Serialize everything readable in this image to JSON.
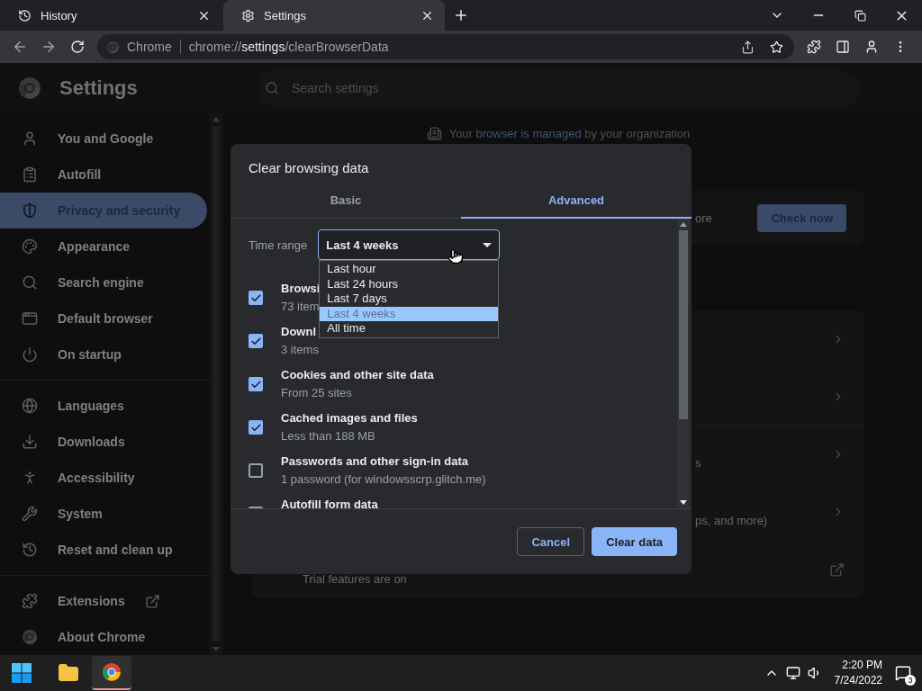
{
  "browser_tabs": [
    {
      "title": "History",
      "selected": false
    },
    {
      "title": "Settings",
      "selected": true
    }
  ],
  "omnibox": {
    "chip": "Chrome",
    "url": "chrome://**settings**/clearBrowserData"
  },
  "settings_header": {
    "title": "Settings",
    "search_placeholder": "Search settings"
  },
  "sidebar": {
    "groups": [
      [
        {
          "label": "You and Google",
          "selected": false
        },
        {
          "label": "Autofill",
          "selected": false
        },
        {
          "label": "Privacy and security",
          "selected": true
        },
        {
          "label": "Appearance",
          "selected": false
        },
        {
          "label": "Search engine",
          "selected": false
        },
        {
          "label": "Default browser",
          "selected": false
        },
        {
          "label": "On startup",
          "selected": false
        }
      ],
      [
        {
          "label": "Languages",
          "selected": false
        },
        {
          "label": "Downloads",
          "selected": false
        },
        {
          "label": "Accessibility",
          "selected": false
        },
        {
          "label": "System",
          "selected": false
        },
        {
          "label": "Reset and clean up",
          "selected": false
        }
      ],
      [
        {
          "label": "Extensions",
          "selected": false,
          "external": true
        },
        {
          "label": "About Chrome",
          "selected": false
        }
      ]
    ]
  },
  "managed_notice": {
    "before": "Your",
    "link": "browser is managed",
    "after": "by your organization"
  },
  "safety_card": {
    "fragment": "ore",
    "button": "Check now"
  },
  "privacy_card": {
    "rows": [
      {
        "kind": "link"
      },
      {
        "kind": "link"
      },
      {
        "kind": "link",
        "fragment": "s"
      },
      {
        "kind": "link",
        "fragment": "ps, and more)"
      },
      {
        "kind": "external",
        "note": "Trial features are on"
      }
    ]
  },
  "dialog": {
    "title": "Clear browsing data",
    "tabs": [
      {
        "label": "Basic",
        "selected": false
      },
      {
        "label": "Advanced",
        "selected": true
      }
    ],
    "time_range": {
      "label": "Time range",
      "value": "Last 4 weeks",
      "open": true,
      "options": [
        {
          "label": "Last hour",
          "selected": false
        },
        {
          "label": "Last 24 hours",
          "selected": false
        },
        {
          "label": "Last 7 days",
          "selected": false
        },
        {
          "label": "Last 4 weeks",
          "selected": true
        },
        {
          "label": "All time",
          "selected": false
        }
      ]
    },
    "items": [
      {
        "title": "Browsi",
        "detail": "73 item",
        "checked": true
      },
      {
        "title": "Downl",
        "detail": "3 items",
        "checked": true
      },
      {
        "title": "Cookies and other site data",
        "detail": "From 25 sites",
        "checked": true
      },
      {
        "title": "Cached images and files",
        "detail": "Less than 188 MB",
        "checked": true
      },
      {
        "title": "Passwords and other sign-in data",
        "detail": "1 password (for windowsscrp.glitch.me)",
        "checked": false
      },
      {
        "title": "Autofill form data",
        "checked": false
      }
    ],
    "buttons": [
      {
        "label": "Cancel",
        "kind": "secondary"
      },
      {
        "label": "Clear data",
        "kind": "primary"
      }
    ]
  },
  "taskbar": {
    "time": "2:20 PM",
    "date": "7/24/2022",
    "notifications": "3"
  }
}
